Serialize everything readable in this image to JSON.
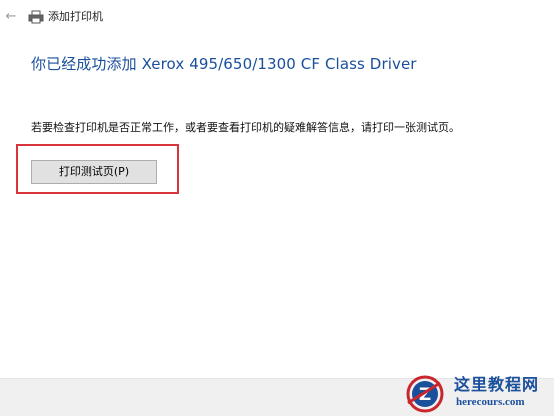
{
  "window": {
    "title": "添加打印机",
    "back_icon": "back-arrow-icon",
    "title_icon": "printer-icon"
  },
  "main": {
    "heading": "你已经成功添加 Xerox 495/650/1300 CF Class Driver",
    "description": "若要检查打印机是否正常工作，或者要查看打印机的疑难解答信息，请打印一张测试页。",
    "print_test_page_button": "打印测试页(P)"
  },
  "watermark": {
    "site_name": "这里教程网",
    "url": "herecours.com"
  },
  "colors": {
    "heading": "#1a4f9c",
    "highlight_border": "#d9333b",
    "button_bg": "#e1e1e1",
    "footer_bg": "#f0f0f0"
  }
}
